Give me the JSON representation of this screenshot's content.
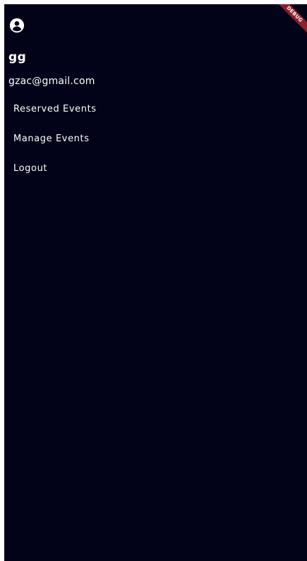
{
  "drawer": {
    "avatar_icon": "account-circle-icon",
    "username": "gg",
    "email": "gzac@gmail.com",
    "menu": [
      {
        "label": "Reserved Events"
      },
      {
        "label": "Manage Events"
      },
      {
        "label": "Logout"
      }
    ],
    "background_color": "#020218",
    "text_color": "#ffffff"
  },
  "debug_banner": {
    "label": "DEBUG",
    "color": "#8b1f2a"
  }
}
